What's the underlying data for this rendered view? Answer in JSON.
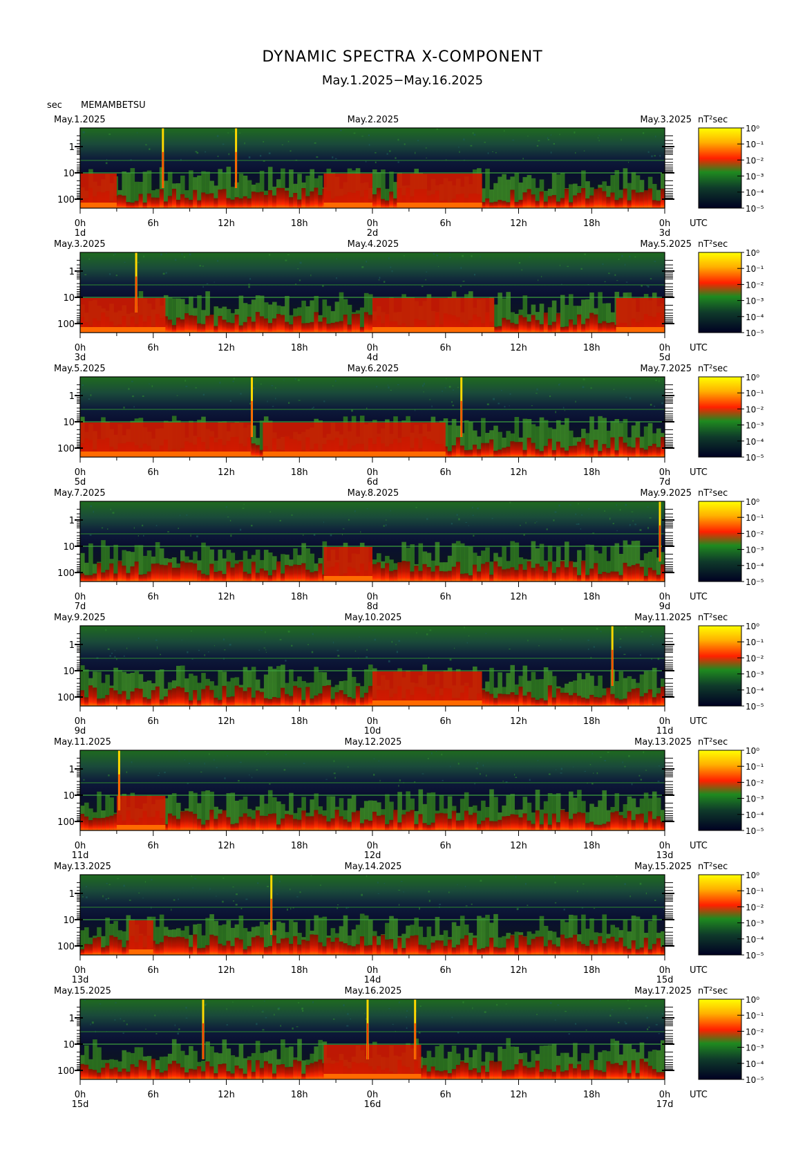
{
  "page": {
    "title": "DYNAMIC SPECTRA X-COMPONENT",
    "subtitle": "May.1.2025−May.16.2025",
    "unit_label": "sec",
    "station": "MEMAMBETSU"
  },
  "chart_data": {
    "type": "heatmap",
    "title": "DYNAMIC SPECTRA X-COMPONENT",
    "subtitle": "May.1.2025−May.16.2025",
    "ylabel": "sec",
    "y_tick_labels": [
      "1",
      "10",
      "100"
    ],
    "y_scale": "log",
    "x_tick_labels": [
      "0h",
      "6h",
      "12h",
      "18h",
      "0h",
      "6h",
      "12h",
      "18h",
      "0h"
    ],
    "x_unit_label": "UTC",
    "colorbar": {
      "unit": "nT²sec",
      "tick_labels": [
        "10⁰",
        "10⁻¹",
        "10⁻²",
        "10⁻³",
        "10⁻⁴",
        "10⁻⁵"
      ],
      "colors": [
        "#ffff00",
        "#ff8000",
        "#ff0000",
        "#228b22",
        "#006400",
        "#000033"
      ]
    },
    "panels": [
      {
        "date_left": "May.1.2025",
        "date_mid": "May.2.2025",
        "date_right": "May.3.2025",
        "day_left": "1d",
        "day_mid": "2d",
        "day_right": "3d",
        "spikes_hours": [
          6.8,
          12.8
        ],
        "red_band_segments": [
          [
            0,
            3
          ],
          [
            20,
            24
          ],
          [
            26,
            33
          ]
        ]
      },
      {
        "date_left": "May.3.2025",
        "date_mid": "May.4.2025",
        "date_right": "May.5.2025",
        "day_left": "3d",
        "day_mid": "4d",
        "day_right": "5d",
        "spikes_hours": [
          4.6
        ],
        "red_band_segments": [
          [
            0,
            7
          ],
          [
            24,
            34
          ],
          [
            44,
            48
          ]
        ]
      },
      {
        "date_left": "May.5.2025",
        "date_mid": "May.6.2025",
        "date_right": "May.7.2025",
        "day_left": "5d",
        "day_mid": "6d",
        "day_right": "7d",
        "spikes_hours": [
          14.1,
          31.3
        ],
        "red_band_segments": [
          [
            0,
            14
          ],
          [
            15,
            30
          ]
        ]
      },
      {
        "date_left": "May.7.2025",
        "date_mid": "May.8.2025",
        "date_right": "May.9.2025",
        "day_left": "7d",
        "day_mid": "8d",
        "day_right": "9d",
        "spikes_hours": [
          47.6
        ],
        "red_band_segments": [
          [
            20,
            24
          ]
        ]
      },
      {
        "date_left": "May.9.2025",
        "date_mid": "May.10.2025",
        "date_right": "May.11.2025",
        "day_left": "9d",
        "day_mid": "10d",
        "day_right": "11d",
        "spikes_hours": [
          43.7
        ],
        "red_band_segments": [
          [
            24,
            33
          ]
        ]
      },
      {
        "date_left": "May.11.2025",
        "date_mid": "May.12.2025",
        "date_right": "May.13.2025",
        "day_left": "11d",
        "day_mid": "12d",
        "day_right": "13d",
        "spikes_hours": [
          3.2
        ],
        "red_band_segments": [
          [
            3,
            7
          ]
        ]
      },
      {
        "date_left": "May.13.2025",
        "date_mid": "May.14.2025",
        "date_right": "May.15.2025",
        "day_left": "13d",
        "day_mid": "14d",
        "day_right": "15d",
        "spikes_hours": [
          15.7
        ],
        "red_band_segments": [
          [
            4,
            6
          ]
        ]
      },
      {
        "date_left": "May.15.2025",
        "date_mid": "May.16.2025",
        "date_right": "May.17.2025",
        "day_left": "15d",
        "day_mid": "16d",
        "day_right": "17d",
        "spikes_hours": [
          10.1,
          23.6,
          27.5
        ],
        "red_band_segments": [
          [
            20,
            28
          ]
        ]
      }
    ]
  }
}
